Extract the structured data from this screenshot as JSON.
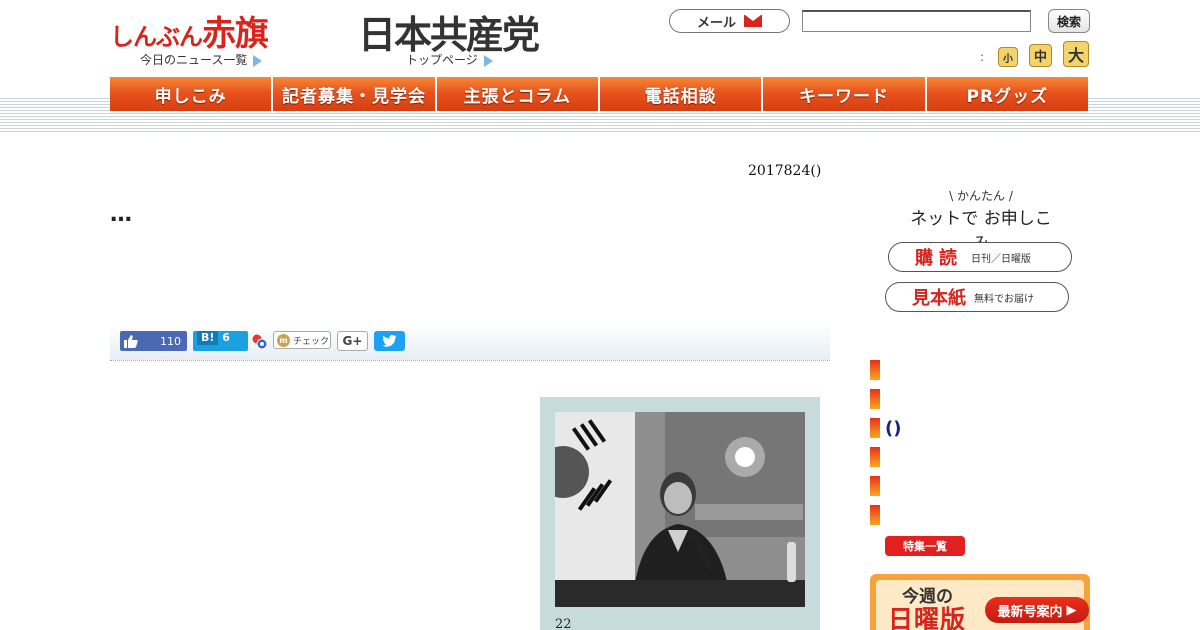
{
  "header": {
    "akahata_logo_small": "しんぶん",
    "akahata_logo_big": "赤旗",
    "jcp_logo": "日本共産党",
    "news_list_link": "今日のニュース一覧",
    "top_page_link": "トップページ",
    "mail_label": "メール",
    "search_value": "",
    "search_button": "検索",
    "font_size_colon": ":",
    "font_small": "小",
    "font_medium": "中",
    "font_large": "大"
  },
  "nav": {
    "items": [
      "申しこみ",
      "記者募集・見学会",
      "主張とコラム",
      "電話相談",
      "キーワード",
      "PRグッズ"
    ]
  },
  "article": {
    "date": "2017824()",
    "title": "…",
    "photo_caption": "22"
  },
  "share": {
    "like_count": "110",
    "hatena_label": "B!",
    "hatena_count": "6",
    "check_label": "チェック",
    "gplus_label": "G+"
  },
  "sidebar": {
    "net_kantan": "かんたん",
    "net_prefix": "ネットで",
    "net_suffix": "お申しこみ",
    "subscribe_label": "購読",
    "subscribe_note": "日刊／日曜版",
    "sample_label": "見本紙",
    "sample_note": "無料でお届け",
    "paren_item": "()",
    "feature_list_button": "特集一覧",
    "sunday_week": "今週の",
    "sunday_title": "日曜版",
    "latest_button": "最新号案内"
  },
  "colors": {
    "brand_red": "#d8241c",
    "nav_orange": "#e8531d",
    "twitter_blue": "#1da1f2",
    "facebook_blue": "#4a68b3",
    "hatena_blue": "#1aa1e0"
  }
}
